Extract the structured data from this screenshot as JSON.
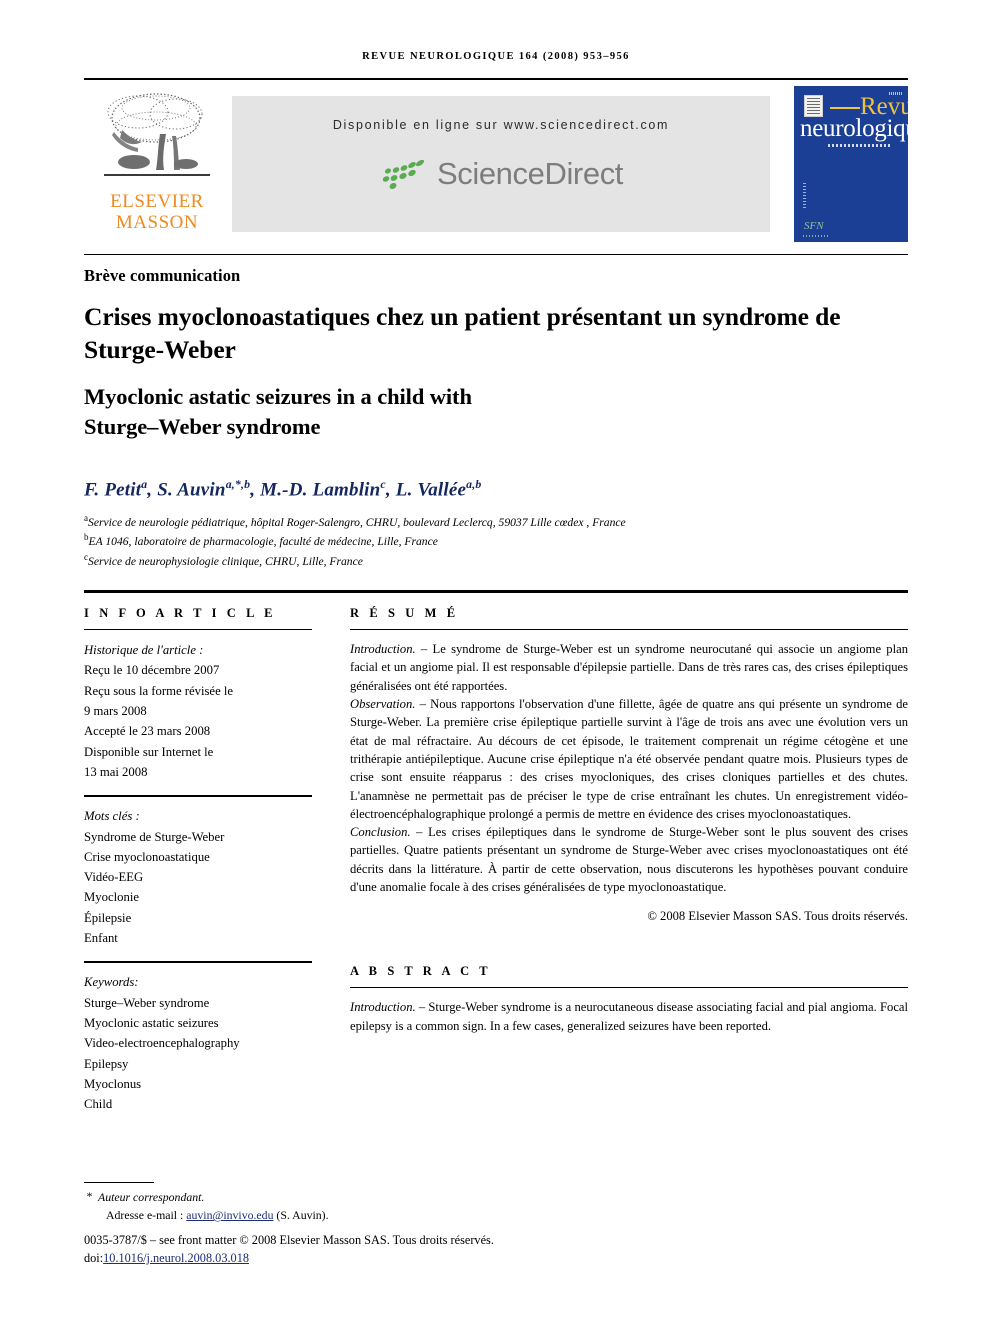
{
  "running_head": "REVUE NEUROLOGIQUE 164 (2008) 953–956",
  "masthead": {
    "publisher_logo_name": "elsevier-masson-logo",
    "publisher_line1": "ELSEVIER",
    "publisher_line2": "MASSON",
    "availability_text": "Disponible en ligne sur www.sciencedirect.com",
    "sciencedirect_wordmark": "ScienceDirect",
    "cover": {
      "title_line1": "Revue",
      "title_line2": "neurologique",
      "emblem": "SFN",
      "bg_color": "#1b3f94",
      "accent_color": "#f0c040"
    },
    "band_bg_color": "#e4e4e4",
    "publisher_color": "#ED8B22",
    "sciencedirect_green": "#5aab51",
    "sciencedirect_gray": "#7d7d7d"
  },
  "article": {
    "type": "Brève communication",
    "title_fr": "Crises myoclonoastatiques chez un patient présentant un syndrome de Sturge-Weber",
    "title_en_line1": "Myoclonic astatic seizures in a child with",
    "title_en_line2": "Sturge–Weber syndrome",
    "authors_html": "F. Petit<sup>a</sup>, S. Auvin<sup>a,*,b</sup>, M.-D. Lamblin<sup>c</sup>, L. Vallée<sup>a,b</sup>",
    "authors_plain": "F. Petit a, S. Auvin a,*,b, M.-D. Lamblin c, L. Vallée a,b",
    "author_color": "#14275e",
    "affiliations": [
      {
        "mark": "a",
        "text": "Service de neurologie pédiatrique, hôpital Roger-Salengro, CHRU, boulevard Leclercq, 59037 Lille cœdex , France"
      },
      {
        "mark": "b",
        "text": "EA 1046, laboratoire de pharmacologie, faculté de médecine, Lille, France"
      },
      {
        "mark": "c",
        "text": "Service de neurophysiologie clinique, CHRU, Lille, France"
      }
    ]
  },
  "info_article": {
    "heading": "I N F O   A R T I C L E",
    "history_label": "Historique de l'article :",
    "history_lines": [
      "Reçu le 10 décembre 2007",
      "Reçu sous la forme révisée le",
      "9 mars 2008",
      "Accepté le  23 mars 2008",
      "Disponible sur Internet le",
      "13 mai 2008"
    ],
    "motscles_label": "Mots clés :",
    "motscles": [
      "Syndrome de Sturge-Weber",
      "Crise myoclonoastatique",
      "Vidéo-EEG",
      "Myoclonie",
      "Épilepsie",
      "Enfant"
    ],
    "keywords_label": "Keywords:",
    "keywords": [
      "Sturge–Weber syndrome",
      "Myoclonic astatic seizures",
      "Video-electroencephalography",
      "Epilepsy",
      "Myoclonus",
      "Child"
    ]
  },
  "resume": {
    "heading": "R É S U M É",
    "paragraphs": [
      {
        "run_in": "Introduction.",
        "dash": " – ",
        "text": "Le syndrome de Sturge-Weber est un syndrome neurocutané qui associe un angiome plan facial et un angiome pial. Il est responsable d'épilepsie partielle. Dans de très rares cas, des crises épileptiques généralisées ont été rapportées."
      },
      {
        "run_in": "Observation.",
        "dash": " – ",
        "text": "Nous rapportons l'observation d'une fillette, âgée de quatre ans qui présente un syndrome de Sturge-Weber. La première crise épileptique partielle survint à l'âge de trois ans avec une évolution vers un état de mal réfractaire. Au décours de cet épisode, le traitement comprenait un régime cétogène et une trithérapie antiépileptique. Aucune crise épileptique n'a été observée pendant quatre mois. Plusieurs types de crise sont ensuite réapparus : des crises myocloniques, des crises cloniques partielles et des chutes. L'anamnèse ne permettait pas de préciser le type de crise entraînant les chutes. Un enregistrement vidéo-électroencéphalographique prolongé a permis de mettre en évidence des crises myoclonoastatiques."
      },
      {
        "run_in": "Conclusion.",
        "dash": " – ",
        "text": "Les crises épileptiques dans le syndrome de Sturge-Weber sont le plus souvent des crises partielles. Quatre patients présentant un syndrome de Sturge-Weber avec crises myoclonoastatiques ont été décrits dans la littérature. À partir de cette observation, nous discuterons les hypothèses pouvant conduire d'une anomalie focale à des crises généralisées de type myoclonoastatique."
      }
    ],
    "copyright": "© 2008 Elsevier Masson SAS. Tous droits réservés."
  },
  "abstract": {
    "heading": "A B S T R A C T",
    "paragraphs": [
      {
        "run_in": "Introduction.",
        "dash": " – ",
        "text": "Sturge-Weber syndrome is a neurocutaneous disease associating facial and pial angioma. Focal epilepsy is a common sign. In a few cases, generalized seizures have been reported."
      }
    ]
  },
  "footer": {
    "corresponding_star": "*",
    "corresponding_label": "Auteur correspondant.",
    "email_label": "Adresse e-mail : ",
    "email": "auvin@invivo.edu",
    "email_owner": " (S. Auvin).",
    "frontmatter": "0035-3787/$ – see front matter © 2008 Elsevier Masson SAS. Tous droits réservés.",
    "doi_label": "doi:",
    "doi": "10.1016/j.neurol.2008.03.018",
    "link_color": "#1c2d72"
  }
}
